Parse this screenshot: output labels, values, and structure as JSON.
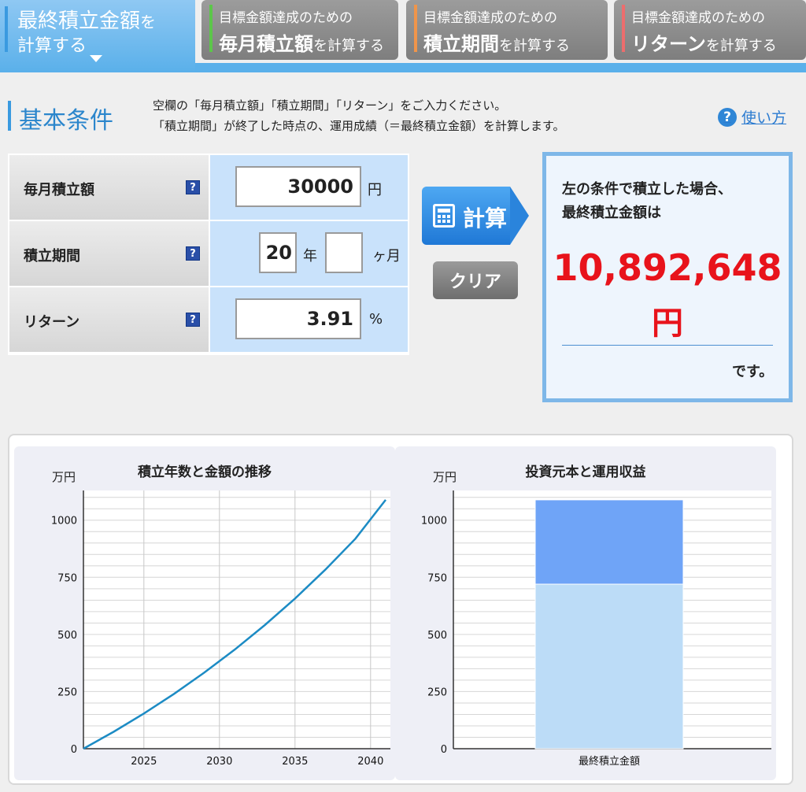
{
  "tabs": [
    {
      "line1": "最終積立金額",
      "line1_suffix": "を",
      "line2": "計算する",
      "active": true,
      "accent": "#3a9ae0"
    },
    {
      "line1": "目標金額達成のための",
      "big": "毎月積立額",
      "small": "を計算する",
      "active": false,
      "accent": "#5cc64a"
    },
    {
      "line1": "目標金額達成のための",
      "big": "積立期間",
      "small": "を計算する",
      "active": false,
      "accent": "#f0954a"
    },
    {
      "line1": "目標金額達成のための",
      "big": "リターン",
      "small": "を計算する",
      "active": false,
      "accent": "#ec6d6d"
    }
  ],
  "section": {
    "title": "基本条件",
    "intro_line1": "空欄の「毎月積立額」「積立期間」「リターン」をご入力ください。",
    "intro_line2": "「積立期間」が終了した時点の、運用成績（＝最終積立金額）を計算します。",
    "help_label": "使い方",
    "help_icon": "?"
  },
  "form": {
    "monthly_label": "毎月積立額",
    "monthly_value": "30000",
    "monthly_unit": "円",
    "period_label": "積立期間",
    "period_years": "20",
    "period_years_unit": "年",
    "period_months": "",
    "period_months_unit": "ヶ月",
    "return_label": "リターン",
    "return_value": "3.91",
    "return_unit": "%",
    "help_icon": "?"
  },
  "buttons": {
    "calc_label": "計算",
    "clear_label": "クリア"
  },
  "result": {
    "line1": "左の条件で積立した場合、",
    "line2": "最終積立金額は",
    "amount": "10,892,648",
    "currency": "円",
    "suffix": "です。"
  },
  "chart_data": [
    {
      "type": "line",
      "title": "積立年数と金額の推移",
      "ylabel": "万円",
      "xlabel": "",
      "x": [
        2021,
        2023,
        2025,
        2027,
        2029,
        2031,
        2033,
        2035,
        2037,
        2039,
        2041
      ],
      "series": [
        {
          "values": [
            0,
            74,
            154,
            240,
            333,
            433,
            541,
            657,
            783,
            919,
            1089
          ]
        }
      ],
      "xticks": [
        "2025",
        "2030",
        "2035",
        "2040"
      ],
      "yticks": [
        "0",
        "250",
        "500",
        "750",
        "1000"
      ],
      "xlim": [
        2021,
        2041
      ],
      "ylim": [
        0,
        1130
      ],
      "grid": true,
      "color": "#1c8bc4"
    },
    {
      "type": "bar",
      "title": "投資元本と運用収益",
      "ylabel": "万円",
      "categories": [
        "最終積立金額"
      ],
      "series": [
        {
          "values": [
            720
          ]
        },
        {
          "values": [
            369
          ]
        }
      ],
      "yticks": [
        "0",
        "250",
        "500",
        "750",
        "1000"
      ],
      "ylim": [
        0,
        1130
      ],
      "grid": true,
      "colors": [
        "#bcdcf7",
        "#6fa4f7"
      ]
    }
  ]
}
